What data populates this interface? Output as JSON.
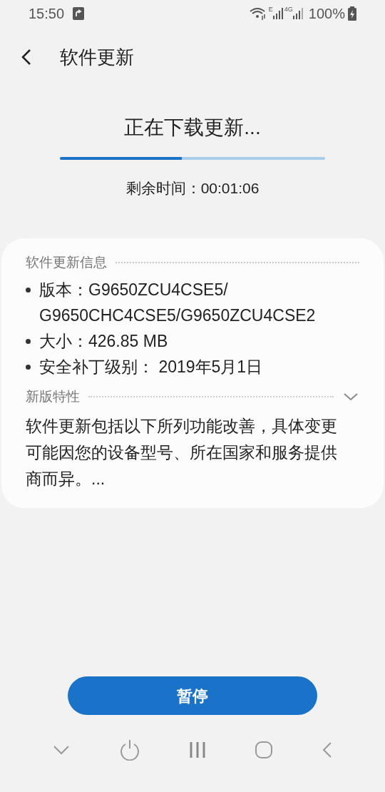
{
  "status_bar": {
    "time": "15:50",
    "network_label": "E",
    "network_type": "4G",
    "battery": "100%"
  },
  "header": {
    "title": "软件更新"
  },
  "download": {
    "title": "正在下载更新...",
    "level": 0.46,
    "remaining": "剩余时间：00:01:06"
  },
  "info": {
    "heading": "软件更新信息",
    "items": [
      "版本：G9650ZCU4CSE5/ G9650CHC4CSE5/G9650ZCU4CSE2",
      "大小：426.85 MB",
      "安全补丁级别： 2019年5月1日"
    ]
  },
  "features": {
    "heading": "新版特性",
    "expanded": false,
    "text": "软件更新包括以下所列功能改善，具体变更可能因您的设备型号、所在国家和服务提供商而异。..."
  },
  "pause_button": "暂停"
}
